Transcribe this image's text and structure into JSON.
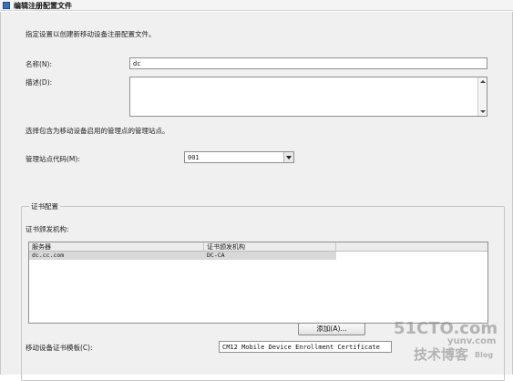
{
  "window": {
    "title": "编辑注册配置文件"
  },
  "intro": "指定设置以创建新移动设备注册配置文件。",
  "name_field": {
    "label": "名称(N):",
    "value": "dc"
  },
  "description_field": {
    "label": "描述(D):",
    "value": ""
  },
  "site_instruction": "选择包含为移动设备启用的管理点的管理站点。",
  "site_code": {
    "label": "管理站点代码(M):",
    "selected": "001"
  },
  "certificate_config": {
    "group_title": "证书配置",
    "ca_label": "证书颁发机构:",
    "columns": [
      "服务器",
      "证书颁发机构"
    ],
    "rows": [
      {
        "server": "dc.cc.com",
        "ca": "DC-CA"
      }
    ],
    "add_button": "添加(A)...",
    "template_label": "移动设备证书模板(C):",
    "template_value": "CM12 Mobile Device Enrollment Certificate"
  },
  "watermark": {
    "site": "51CTO.com",
    "text": "技术博客",
    "sub": "Blog",
    "site2": "yunv.com"
  }
}
